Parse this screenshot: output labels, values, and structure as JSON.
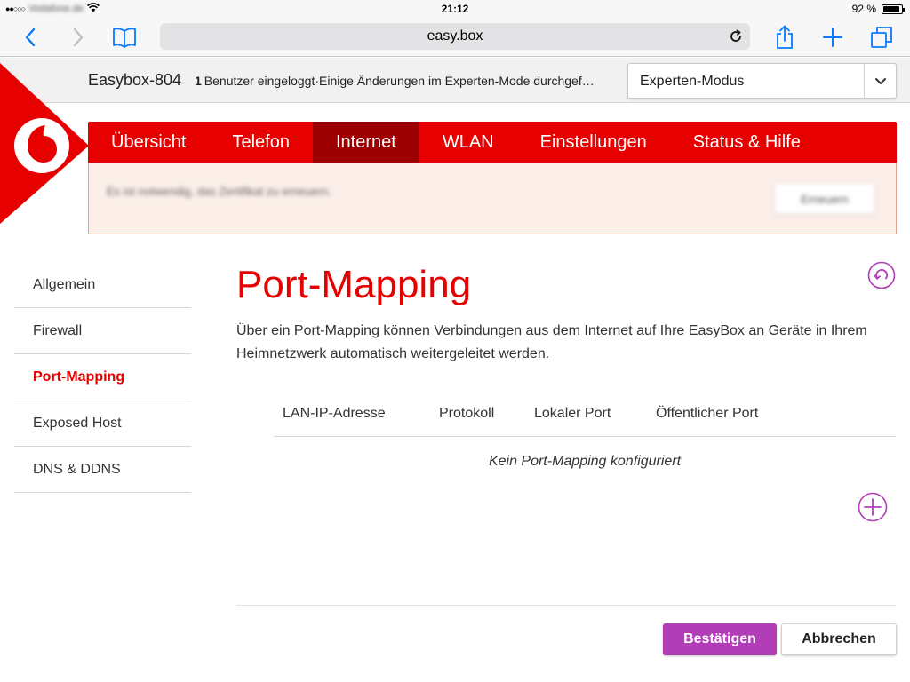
{
  "status_bar": {
    "carrier": "Vodafone.de",
    "time": "21:12",
    "battery": "92 %",
    "battery_level": 0.92
  },
  "browser": {
    "url": "easy.box",
    "icons": {
      "back": "chevron-left-icon",
      "forward": "chevron-right-icon",
      "bookmarks": "book-icon",
      "reload": "reload-icon",
      "share": "share-icon",
      "new_tab": "plus-icon",
      "tabs": "tabs-icon"
    },
    "accent": "#0a7aff"
  },
  "header": {
    "model": "Easybox-804",
    "user_count": "1",
    "notice": "Benutzer eingeloggt·Einige Änderungen im Experten-Mode durchgef…",
    "mode_selected": "Experten-Modus"
  },
  "brand": {
    "logo": "vodafone-logo",
    "primary_color": "#e60000",
    "active_nav_color": "#9c0000",
    "button_color": "#b13eb6"
  },
  "nav": {
    "items": [
      {
        "label": "Übersicht",
        "active": false
      },
      {
        "label": "Telefon",
        "active": false
      },
      {
        "label": "Internet",
        "active": true
      },
      {
        "label": "WLAN",
        "active": false
      },
      {
        "label": "Einstellungen",
        "active": false
      },
      {
        "label": "Status & Hilfe",
        "active": false
      }
    ]
  },
  "alert": {
    "message": "Es ist notwendig, das Zertifikat zu erneuern.",
    "button": "Erneuern"
  },
  "sidebar": {
    "items": [
      {
        "label": "Allgemein",
        "active": false
      },
      {
        "label": "Firewall",
        "active": false
      },
      {
        "label": "Port-Mapping",
        "active": true
      },
      {
        "label": "Exposed Host",
        "active": false
      },
      {
        "label": "DNS & DDNS",
        "active": false
      }
    ]
  },
  "main": {
    "title": "Port-Mapping",
    "description": "Über ein Port-Mapping können Verbindungen aus dem Internet auf Ihre EasyBox an Geräte in Ihrem Heimnetzwerk automatisch weitergeleitet werden.",
    "table": {
      "columns": [
        "LAN-IP-Adresse",
        "Protokoll",
        "Lokaler Port",
        "Öffentlicher Port"
      ],
      "rows": [],
      "empty_text": "Kein Port-Mapping konfiguriert"
    }
  },
  "footer": {
    "confirm": "Bestätigen",
    "cancel": "Abbrechen"
  }
}
